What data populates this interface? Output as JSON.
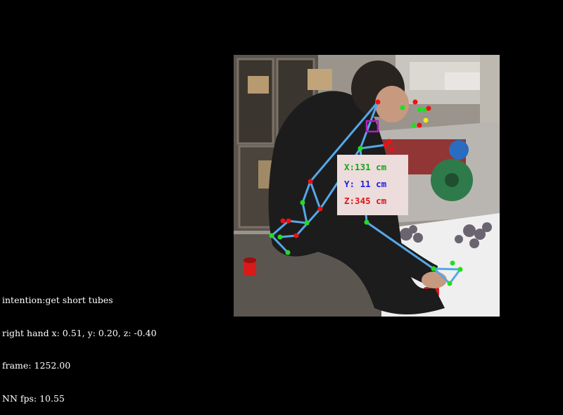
{
  "hud": {
    "intention": "intention:get short tubes",
    "right_hand": "right hand x: 0.51, y: 0.20, z: -0.40",
    "frame": "frame: 1252.00",
    "nn_fps": "NN fps: 10.55"
  },
  "coordinates": {
    "x_label": "X:131 cm",
    "y_label": "Y: 11 cm",
    "z_label": "Z:345 cm",
    "x_color": "#14a814",
    "y_color": "#1e1ee6",
    "z_color": "#e01414"
  },
  "colors": {
    "skeleton": "#55a8e8",
    "joint_green": "#22dd22",
    "joint_red": "#ee1111",
    "joint_yellow": "#f0e81a",
    "target_box": "#b020c0"
  }
}
